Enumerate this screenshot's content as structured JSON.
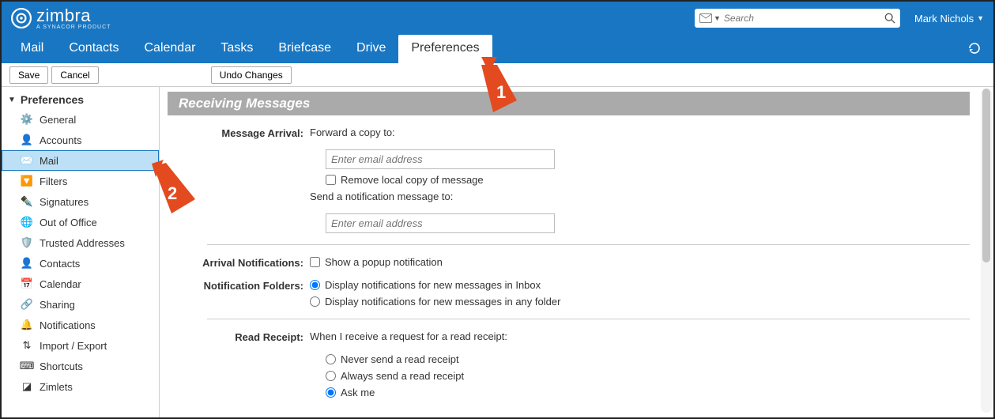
{
  "brand": {
    "name": "zimbra",
    "tagline": "A SYNACOR PRODUCT"
  },
  "search": {
    "placeholder": "Search"
  },
  "user": {
    "name": "Mark Nichols"
  },
  "tabs": [
    "Mail",
    "Contacts",
    "Calendar",
    "Tasks",
    "Briefcase",
    "Drive",
    "Preferences"
  ],
  "activeTab": "Preferences",
  "toolbar": {
    "save": "Save",
    "cancel": "Cancel",
    "undo": "Undo Changes"
  },
  "sidebar": {
    "header": "Preferences",
    "items": [
      {
        "label": "General",
        "icon": "gear"
      },
      {
        "label": "Accounts",
        "icon": "user"
      },
      {
        "label": "Mail",
        "icon": "mail",
        "selected": true
      },
      {
        "label": "Filters",
        "icon": "filter"
      },
      {
        "label": "Signatures",
        "icon": "sign"
      },
      {
        "label": "Out of Office",
        "icon": "globe"
      },
      {
        "label": "Trusted Addresses",
        "icon": "shield"
      },
      {
        "label": "Contacts",
        "icon": "contact"
      },
      {
        "label": "Calendar",
        "icon": "calendar"
      },
      {
        "label": "Sharing",
        "icon": "share"
      },
      {
        "label": "Notifications",
        "icon": "bell"
      },
      {
        "label": "Import / Export",
        "icon": "import"
      },
      {
        "label": "Shortcuts",
        "icon": "shortcut"
      },
      {
        "label": "Zimlets",
        "icon": "zimlet"
      }
    ]
  },
  "section": {
    "title": "Receiving Messages",
    "messageArrival": {
      "label": "Message Arrival:",
      "forwardLabel": "Forward a copy to:",
      "forwardPlaceholder": "Enter email address",
      "removeLocal": "Remove local copy of message",
      "notifyLabel": "Send a notification message to:",
      "notifyPlaceholder": "Enter email address"
    },
    "arrivalNotifications": {
      "label": "Arrival Notifications:",
      "popup": "Show a popup notification"
    },
    "notificationFolders": {
      "label": "Notification Folders:",
      "inbox": "Display notifications for new messages in Inbox",
      "anyFolder": "Display notifications for new messages in any folder",
      "selected": "inbox"
    },
    "readReceipt": {
      "label": "Read Receipt:",
      "intro": "When I receive a request for a read receipt:",
      "never": "Never send a read receipt",
      "always": "Always send a read receipt",
      "ask": "Ask me",
      "selected": "ask"
    }
  },
  "annotations": {
    "arrow1": "1",
    "arrow2": "2"
  }
}
